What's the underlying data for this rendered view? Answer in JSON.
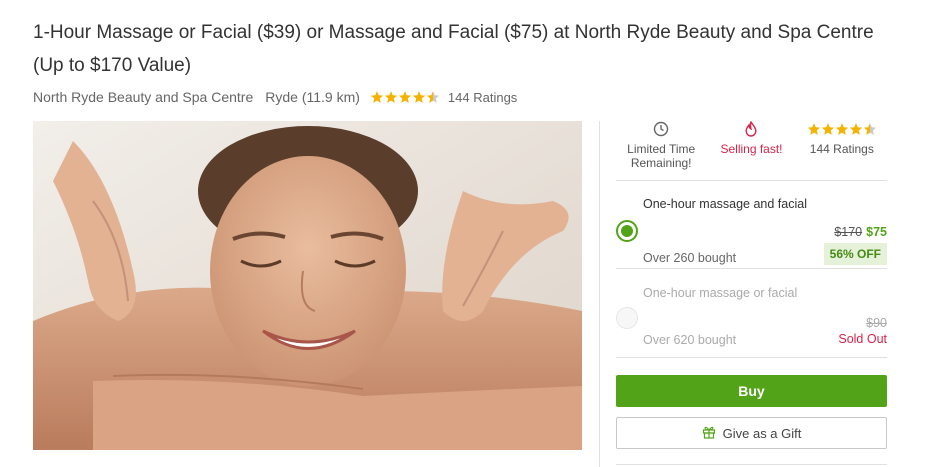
{
  "deal": {
    "title": "1-Hour Massage or Facial ($39) or Massage and Facial ($75) at North Ryde Beauty and Spa Centre (Up to $170 Value)",
    "merchant": "North Ryde Beauty and Spa Centre",
    "location": "Ryde (11.9 km)",
    "rating": 4.5,
    "ratings_label": "144 Ratings"
  },
  "hero_image": {
    "alt": "Woman receiving a shoulder massage",
    "colors": {
      "background": "#e8e2da",
      "skin": "#d8a98a",
      "hair": "#5a3e2b"
    }
  },
  "stats": {
    "time_label": "Limited Time Remaining!",
    "time_icon": "clock-icon",
    "selling_label": "Selling fast!",
    "selling_icon": "flame-icon",
    "ratings_label": "144 Ratings",
    "rating": 4.5
  },
  "options": [
    {
      "name": "One-hour massage and facial",
      "original_price": "$170",
      "price": "$75",
      "bought": "Over 260 bought",
      "discount": "56% OFF",
      "selected": true
    },
    {
      "name": "One-hour massage or facial",
      "original_price": "$90",
      "bought": "Over 620 bought",
      "status": "Sold Out",
      "selected": false
    }
  ],
  "actions": {
    "buy_label": "Buy",
    "gift_label": "Give as a Gift",
    "gift_icon": "gift-icon"
  },
  "colors": {
    "accent": "#53a318",
    "alert": "#d9234a",
    "star": "#f5b301"
  }
}
